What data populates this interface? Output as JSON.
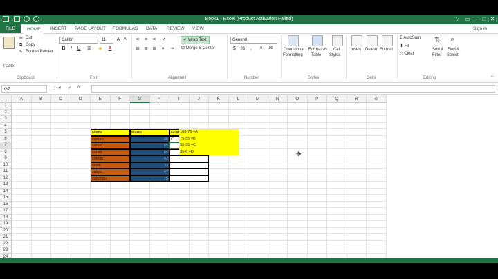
{
  "window": {
    "title": "Book1 - Excel (Product Activation Failed)"
  },
  "ribbon_tabs": [
    "FILE",
    "HOME",
    "INSERT",
    "PAGE LAYOUT",
    "FORMULAS",
    "DATA",
    "REVIEW",
    "VIEW"
  ],
  "signin": "Sign in",
  "clipboard": {
    "paste": "Paste",
    "cut": "Cut",
    "copy": "Copy",
    "format_painter": "Format Painter",
    "label": "Clipboard"
  },
  "font": {
    "name": "Calibri",
    "size": "11",
    "bold": "B",
    "italic": "I",
    "underline": "U",
    "grow": "A",
    "shrink": "A",
    "label": "Font"
  },
  "alignment": {
    "wrap_text": "Wrap Text",
    "merge_center": "Merge & Center",
    "label": "Alignment"
  },
  "number": {
    "format": "General",
    "label": "Number"
  },
  "styles": {
    "cond": "Conditional",
    "cond2": "Formatting",
    "fmt_table": "Format as",
    "fmt_table2": "Table",
    "cell_styles": "Cell",
    "cell_styles2": "Styles",
    "label": "Styles"
  },
  "cells": {
    "insert": "Insert",
    "delete": "Delete",
    "format": "Format",
    "label": "Cells"
  },
  "editing": {
    "autosum": "AutoSum",
    "fill": "Fill",
    "clear": "Clear",
    "sort": "Sort &",
    "sort2": "Filter",
    "find": "Find &",
    "find2": "Select",
    "label": "Editing"
  },
  "formula_bar": {
    "name_box": "G7",
    "fx": "fx",
    "value": ""
  },
  "grid": {
    "columns": [
      "A",
      "B",
      "C",
      "D",
      "E",
      "F",
      "G",
      "H",
      "I",
      "J",
      "K",
      "L",
      "M",
      "N",
      "O",
      "P",
      "Q",
      "R",
      "S"
    ],
    "rows": [
      "1",
      "2",
      "3",
      "4",
      "5",
      "6",
      "7",
      "8",
      "9",
      "10",
      "11",
      "12",
      "13",
      "14",
      "15",
      "16",
      "17",
      "18",
      "19",
      "20",
      "21",
      "22",
      "23",
      "24"
    ],
    "selected_cell": "G7"
  },
  "table": {
    "headers": [
      "Name",
      "Marks",
      "Grade"
    ],
    "rows": [
      {
        "name": "saman",
        "marks": "46",
        "grade": "C"
      },
      {
        "name": "sahan",
        "marks": "55",
        "grade": ""
      },
      {
        "name": "sanith",
        "marks": "65",
        "grade": ""
      },
      {
        "name": "sumith",
        "marks": "42",
        "grade": ""
      },
      {
        "name": "sinith",
        "marks": "33",
        "grade": ""
      },
      {
        "name": "saliya",
        "marks": "47",
        "grade": ""
      },
      {
        "name": "samindu",
        "marks": "75",
        "grade": ""
      }
    ]
  },
  "legend": [
    "100-75 =A",
    "75-55  =B",
    "55-35  =C",
    "35-0   =D"
  ],
  "colors": {
    "excel_green": "#217346",
    "name_fill": "#c55a11",
    "marks_fill": "#1f4e79",
    "highlight": "#ffff00"
  }
}
